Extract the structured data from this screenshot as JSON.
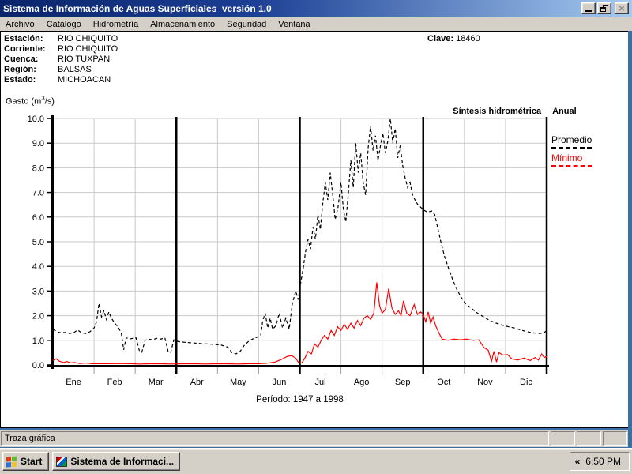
{
  "window": {
    "title": "Sistema de Información de Aguas Superficiales  versión 1.0",
    "buttons": {
      "minimize": "minimize",
      "restore": "restore",
      "close": "×"
    }
  },
  "menu": {
    "items": [
      "Archivo",
      "Catálogo",
      "Hidrometría",
      "Almacenamiento",
      "Seguridad",
      "Ventana"
    ]
  },
  "station_info": {
    "rows": [
      {
        "label": "Estación:",
        "value": "RIO CHIQUITO"
      },
      {
        "label": "Corriente:",
        "value": "RIO CHIQUITO"
      },
      {
        "label": "Cuenca:",
        "value": "RIO TUXPAN"
      },
      {
        "label": "Región:",
        "value": "BALSAS"
      },
      {
        "label": "Estado:",
        "value": "MICHOACAN"
      }
    ],
    "clave_label": "Clave:",
    "clave_value": "18460"
  },
  "chart_header": {
    "y_unit_pre": "Gasto (m",
    "y_unit_sup": "3",
    "y_unit_post": "/s)",
    "subtitle": "Síntesis hidrométrica",
    "mode": "Anual"
  },
  "legend": {
    "promedio": "Promedio",
    "minimo": "Mínimo"
  },
  "chart_data": {
    "type": "line",
    "title": "Síntesis hidrométrica Anual",
    "ylabel": "Gasto (m³/s)",
    "ylim": [
      0,
      10
    ],
    "ytick_step": 1,
    "grid": true,
    "legend_position": "right",
    "x_months": [
      "Ene",
      "Feb",
      "Mar",
      "Abr",
      "May",
      "Jun",
      "Jul",
      "Ago",
      "Sep",
      "Oct",
      "Nov",
      "Dic"
    ],
    "quarter_lines_months": [
      0,
      3,
      6,
      9,
      12
    ],
    "annotation": "Período:  1947 a 1998",
    "series": [
      {
        "name": "Promedio",
        "color": "#000000",
        "style": "dashed",
        "points": [
          [
            0,
            1.45
          ],
          [
            0.1,
            1.35
          ],
          [
            0.2,
            1.3
          ],
          [
            0.3,
            1.32
          ],
          [
            0.4,
            1.28
          ],
          [
            0.5,
            1.3
          ],
          [
            0.6,
            1.42
          ],
          [
            0.7,
            1.3
          ],
          [
            0.8,
            1.28
          ],
          [
            0.9,
            1.35
          ],
          [
            1.0,
            1.5
          ],
          [
            1.06,
            1.75
          ],
          [
            1.12,
            2.5
          ],
          [
            1.18,
            1.95
          ],
          [
            1.24,
            2.2
          ],
          [
            1.3,
            1.85
          ],
          [
            1.36,
            2.15
          ],
          [
            1.42,
            1.9
          ],
          [
            1.5,
            1.7
          ],
          [
            1.58,
            1.55
          ],
          [
            1.66,
            1.3
          ],
          [
            1.72,
            0.62
          ],
          [
            1.78,
            1.1
          ],
          [
            1.86,
            1.05
          ],
          [
            1.94,
            1.08
          ],
          [
            2.02,
            1.1
          ],
          [
            2.1,
            0.58
          ],
          [
            2.16,
            0.52
          ],
          [
            2.24,
            1.0
          ],
          [
            2.32,
            1.05
          ],
          [
            2.42,
            1.02
          ],
          [
            2.52,
            1.08
          ],
          [
            2.62,
            1.05
          ],
          [
            2.72,
            1.1
          ],
          [
            2.8,
            0.55
          ],
          [
            2.86,
            0.5
          ],
          [
            2.94,
            1.02
          ],
          [
            3.05,
            0.95
          ],
          [
            3.2,
            0.92
          ],
          [
            3.35,
            0.9
          ],
          [
            3.5,
            0.88
          ],
          [
            3.65,
            0.86
          ],
          [
            3.8,
            0.85
          ],
          [
            3.95,
            0.83
          ],
          [
            4.1,
            0.8
          ],
          [
            4.25,
            0.72
          ],
          [
            4.35,
            0.5
          ],
          [
            4.45,
            0.45
          ],
          [
            4.55,
            0.55
          ],
          [
            4.65,
            0.8
          ],
          [
            4.75,
            0.95
          ],
          [
            4.85,
            1.05
          ],
          [
            4.95,
            1.12
          ],
          [
            5.05,
            1.2
          ],
          [
            5.1,
            1.8
          ],
          [
            5.16,
            2.1
          ],
          [
            5.22,
            1.5
          ],
          [
            5.28,
            1.9
          ],
          [
            5.34,
            1.45
          ],
          [
            5.42,
            1.6
          ],
          [
            5.5,
            2.1
          ],
          [
            5.58,
            1.5
          ],
          [
            5.66,
            1.9
          ],
          [
            5.74,
            1.45
          ],
          [
            5.82,
            2.5
          ],
          [
            5.9,
            3.0
          ],
          [
            5.96,
            2.65
          ],
          [
            6.02,
            3.3
          ],
          [
            6.08,
            3.9
          ],
          [
            6.14,
            4.6
          ],
          [
            6.2,
            5.1
          ],
          [
            6.26,
            4.7
          ],
          [
            6.32,
            5.6
          ],
          [
            6.38,
            5.1
          ],
          [
            6.44,
            6.1
          ],
          [
            6.5,
            5.5
          ],
          [
            6.56,
            6.6
          ],
          [
            6.62,
            7.4
          ],
          [
            6.68,
            6.7
          ],
          [
            6.74,
            7.8
          ],
          [
            6.8,
            6.9
          ],
          [
            6.86,
            5.9
          ],
          [
            6.93,
            6.4
          ],
          [
            7.0,
            7.4
          ],
          [
            7.06,
            6.3
          ],
          [
            7.12,
            5.8
          ],
          [
            7.18,
            7.0
          ],
          [
            7.24,
            8.3
          ],
          [
            7.3,
            7.2
          ],
          [
            7.36,
            9.0
          ],
          [
            7.42,
            7.8
          ],
          [
            7.48,
            8.6
          ],
          [
            7.54,
            7.4
          ],
          [
            7.6,
            6.9
          ],
          [
            7.66,
            8.8
          ],
          [
            7.72,
            9.7
          ],
          [
            7.78,
            8.7
          ],
          [
            7.84,
            9.3
          ],
          [
            7.9,
            8.3
          ],
          [
            7.96,
            8.9
          ],
          [
            8.02,
            9.4
          ],
          [
            8.08,
            8.6
          ],
          [
            8.14,
            9.1
          ],
          [
            8.2,
            10.0
          ],
          [
            8.26,
            9.0
          ],
          [
            8.32,
            9.6
          ],
          [
            8.38,
            8.4
          ],
          [
            8.44,
            8.9
          ],
          [
            8.5,
            8.1
          ],
          [
            8.56,
            7.6
          ],
          [
            8.62,
            7.2
          ],
          [
            8.68,
            7.4
          ],
          [
            8.74,
            6.9
          ],
          [
            8.8,
            6.7
          ],
          [
            8.87,
            6.5
          ],
          [
            8.94,
            6.4
          ],
          [
            9.0,
            6.3
          ],
          [
            9.1,
            6.2
          ],
          [
            9.2,
            6.25
          ],
          [
            9.28,
            6.1
          ],
          [
            9.36,
            5.5
          ],
          [
            9.44,
            4.9
          ],
          [
            9.52,
            4.4
          ],
          [
            9.62,
            3.9
          ],
          [
            9.72,
            3.45
          ],
          [
            9.82,
            3.05
          ],
          [
            9.92,
            2.75
          ],
          [
            10.02,
            2.5
          ],
          [
            10.17,
            2.3
          ],
          [
            10.32,
            2.1
          ],
          [
            10.47,
            1.95
          ],
          [
            10.62,
            1.8
          ],
          [
            10.77,
            1.7
          ],
          [
            10.92,
            1.62
          ],
          [
            11.07,
            1.55
          ],
          [
            11.22,
            1.5
          ],
          [
            11.37,
            1.42
          ],
          [
            11.52,
            1.35
          ],
          [
            11.67,
            1.3
          ],
          [
            11.82,
            1.28
          ],
          [
            11.93,
            1.3
          ],
          [
            12.0,
            1.4
          ]
        ]
      },
      {
        "name": "Mínimo",
        "color": "#ff0000",
        "style": "solid",
        "points": [
          [
            0,
            0.18
          ],
          [
            0.08,
            0.25
          ],
          [
            0.16,
            0.15
          ],
          [
            0.26,
            0.1
          ],
          [
            0.34,
            0.14
          ],
          [
            0.42,
            0.08
          ],
          [
            0.52,
            0.1
          ],
          [
            0.65,
            0.06
          ],
          [
            0.8,
            0.08
          ],
          [
            0.95,
            0.05
          ],
          [
            1.3,
            0.05
          ],
          [
            1.7,
            0.06
          ],
          [
            2.1,
            0.04
          ],
          [
            2.5,
            0.05
          ],
          [
            2.9,
            0.04
          ],
          [
            3.3,
            0.05
          ],
          [
            3.7,
            0.04
          ],
          [
            4.1,
            0.05
          ],
          [
            4.5,
            0.04
          ],
          [
            4.8,
            0.05
          ],
          [
            5.0,
            0.05
          ],
          [
            5.2,
            0.07
          ],
          [
            5.4,
            0.12
          ],
          [
            5.55,
            0.22
          ],
          [
            5.7,
            0.35
          ],
          [
            5.8,
            0.38
          ],
          [
            5.9,
            0.28
          ],
          [
            5.97,
            0.1
          ],
          [
            6.05,
            0.08
          ],
          [
            6.13,
            0.3
          ],
          [
            6.2,
            0.55
          ],
          [
            6.28,
            0.45
          ],
          [
            6.36,
            0.85
          ],
          [
            6.44,
            0.72
          ],
          [
            6.52,
            1.0
          ],
          [
            6.6,
            1.2
          ],
          [
            6.68,
            1.05
          ],
          [
            6.76,
            1.4
          ],
          [
            6.84,
            1.2
          ],
          [
            6.92,
            1.55
          ],
          [
            7.0,
            1.4
          ],
          [
            7.08,
            1.65
          ],
          [
            7.16,
            1.45
          ],
          [
            7.24,
            1.7
          ],
          [
            7.32,
            1.5
          ],
          [
            7.4,
            1.8
          ],
          [
            7.48,
            1.6
          ],
          [
            7.56,
            1.9
          ],
          [
            7.64,
            2.0
          ],
          [
            7.72,
            1.85
          ],
          [
            7.8,
            2.1
          ],
          [
            7.87,
            3.35
          ],
          [
            7.94,
            2.4
          ],
          [
            8.0,
            2.1
          ],
          [
            8.08,
            2.25
          ],
          [
            8.16,
            3.1
          ],
          [
            8.24,
            2.3
          ],
          [
            8.32,
            2.05
          ],
          [
            8.4,
            2.2
          ],
          [
            8.46,
            2.0
          ],
          [
            8.52,
            2.6
          ],
          [
            8.6,
            2.1
          ],
          [
            8.68,
            2.0
          ],
          [
            8.78,
            2.45
          ],
          [
            8.86,
            2.05
          ],
          [
            8.94,
            2.15
          ],
          [
            9.0,
            2.05
          ],
          [
            9.06,
            1.75
          ],
          [
            9.12,
            2.15
          ],
          [
            9.18,
            1.7
          ],
          [
            9.24,
            1.95
          ],
          [
            9.3,
            1.6
          ],
          [
            9.38,
            1.3
          ],
          [
            9.46,
            1.05
          ],
          [
            9.6,
            1.0
          ],
          [
            9.75,
            1.05
          ],
          [
            9.9,
            1.02
          ],
          [
            10.05,
            1.05
          ],
          [
            10.2,
            1.0
          ],
          [
            10.35,
            1.02
          ],
          [
            10.48,
            0.7
          ],
          [
            10.58,
            0.6
          ],
          [
            10.66,
            0.15
          ],
          [
            10.72,
            0.55
          ],
          [
            10.78,
            0.12
          ],
          [
            10.84,
            0.5
          ],
          [
            10.94,
            0.4
          ],
          [
            11.05,
            0.42
          ],
          [
            11.15,
            0.25
          ],
          [
            11.3,
            0.2
          ],
          [
            11.45,
            0.28
          ],
          [
            11.6,
            0.18
          ],
          [
            11.72,
            0.3
          ],
          [
            11.8,
            0.2
          ],
          [
            11.88,
            0.45
          ],
          [
            11.94,
            0.3
          ],
          [
            12.0,
            0.35
          ]
        ]
      }
    ]
  },
  "status_bar": {
    "text": "Traza gráfica"
  },
  "taskbar": {
    "start_label": "Start",
    "task_label": "Sistema de Informaci...",
    "tray_chevron": "«",
    "clock": "6:50 PM"
  },
  "colors": {
    "titlebar_start": "#0a246a",
    "titlebar_end": "#a6caf0",
    "window_face": "#d4d0c8",
    "desktop": "#3a6ea5",
    "promedio": "#000000",
    "minimo": "#ff0000",
    "gridline": "#c9c9c9"
  }
}
